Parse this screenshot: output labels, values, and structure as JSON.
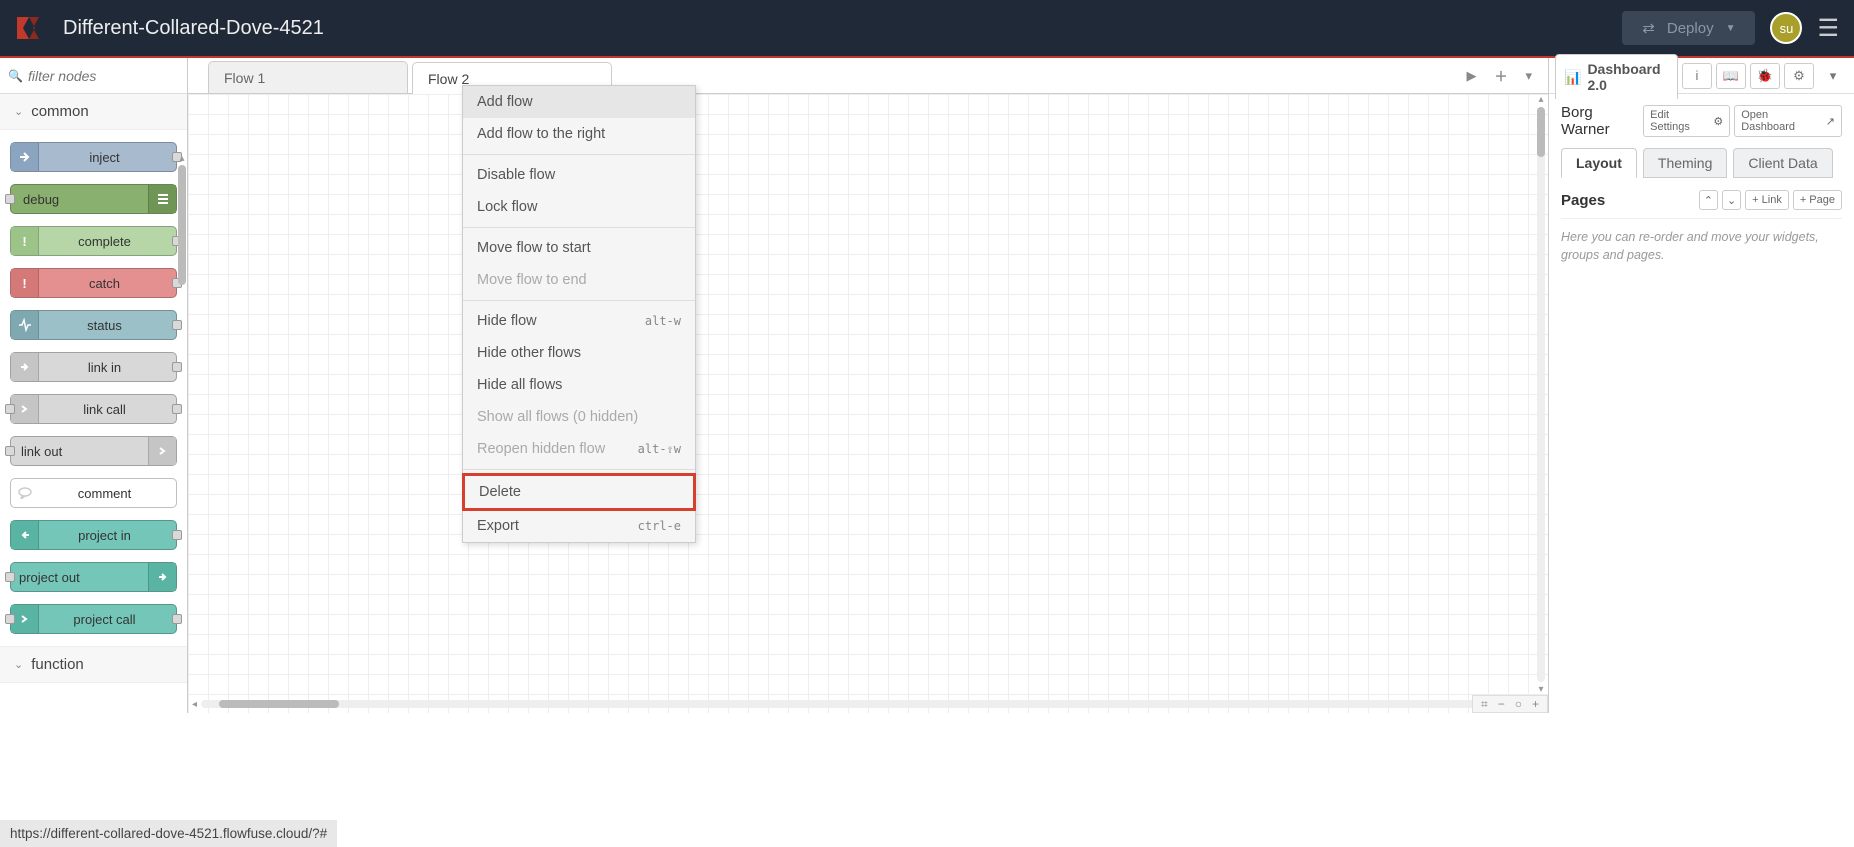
{
  "header": {
    "app_title": "Different-Collared-Dove-4521",
    "deploy_label": "Deploy",
    "avatar_initials": "su"
  },
  "palette": {
    "filter_placeholder": "filter nodes",
    "categories": {
      "common": "common",
      "function": "function"
    },
    "nodes": {
      "inject": "inject",
      "debug": "debug",
      "complete": "complete",
      "catch": "catch",
      "status": "status",
      "link_in": "link in",
      "link_call": "link call",
      "link_out": "link out",
      "comment": "comment",
      "project_in": "project in",
      "project_out": "project out",
      "project_call": "project call"
    }
  },
  "tabs": {
    "flow1": "Flow 1",
    "flow2": "Flow 2"
  },
  "context_menu": {
    "add_flow": "Add flow",
    "add_flow_right": "Add flow to the right",
    "disable_flow": "Disable flow",
    "lock_flow": "Lock flow",
    "move_start": "Move flow to start",
    "move_end": "Move flow to end",
    "hide_flow": "Hide flow",
    "hide_flow_shortcut": "alt-w",
    "hide_other": "Hide other flows",
    "hide_all": "Hide all flows",
    "show_all": "Show all flows (0 hidden)",
    "reopen": "Reopen hidden flow",
    "reopen_shortcut": "alt-⇧w",
    "delete": "Delete",
    "export": "Export",
    "export_shortcut": "ctrl-e"
  },
  "rsidebar": {
    "main_tab": "Dashboard 2.0",
    "project_name": "Borg Warner",
    "edit_settings": "Edit Settings",
    "open_dashboard": "Open Dashboard",
    "tabs": {
      "layout": "Layout",
      "theming": "Theming",
      "client_data": "Client Data"
    },
    "pages_label": "Pages",
    "link_btn": "+ Link",
    "page_btn": "+ Page",
    "hint": "Here you can re-order and move your widgets, groups and pages."
  },
  "status_bar": "https://different-collared-dove-4521.flowfuse.cloud/?#"
}
